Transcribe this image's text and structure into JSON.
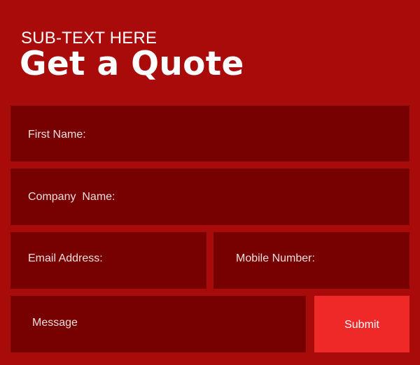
{
  "header": {
    "subtext": "SUB-TEXT HERE",
    "title": "Get a Quote"
  },
  "form": {
    "first_name_label": "First Name:",
    "company_name_label": "Company  Name:",
    "email_label": "Email Address:",
    "mobile_label": "Mobile Number:",
    "message_label": "Message",
    "submit_label": "Submit"
  },
  "colors": {
    "background": "#a90a0a",
    "field": "#770000",
    "submit": "#ef2828",
    "text": "#ffffff"
  }
}
